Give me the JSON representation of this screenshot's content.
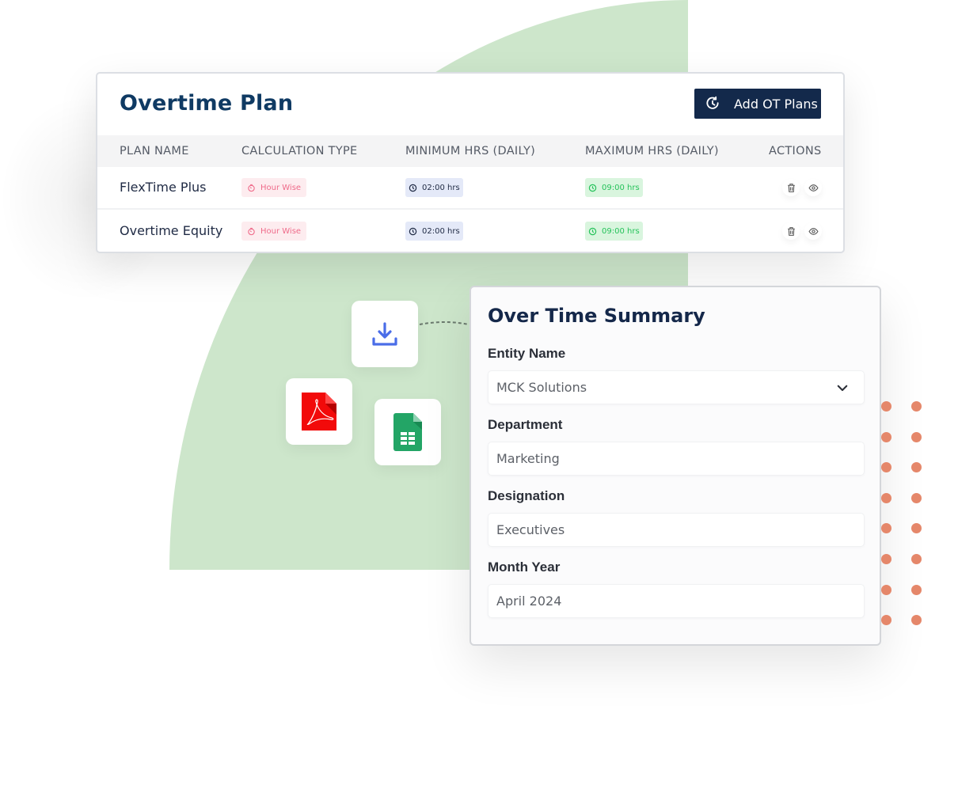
{
  "colors": {
    "accent_navy": "#13294b",
    "title_blue": "#0f3a63",
    "green_blob": "#cde6cb",
    "chip_pink_text": "#ef6b8a",
    "chip_green_text": "#25c25a",
    "dot_orange": "#e5876a"
  },
  "overtime_plan": {
    "title": "Overtime Plan",
    "add_button": {
      "label": "Add OT Plans",
      "icon": "clock-refresh-icon"
    },
    "columns": [
      "PLAN NAME",
      "CALCULATION TYPE",
      "MINIMUM HRS (DAILY)",
      "MAXIMUM HRS (DAILY)",
      "ACTIONS"
    ],
    "rows": [
      {
        "plan_name": "FlexTime Plus",
        "calculation_type": "Hour Wise",
        "min_hrs": "02:00 hrs",
        "max_hrs": "09:00 hrs",
        "actions": [
          "delete-icon",
          "view-icon"
        ]
      },
      {
        "plan_name": "Overtime Equity",
        "calculation_type": "Hour Wise",
        "min_hrs": "02:00 hrs",
        "max_hrs": "09:00 hrs",
        "actions": [
          "delete-icon",
          "view-icon"
        ]
      }
    ]
  },
  "export_tiles": [
    {
      "icon": "download-icon"
    },
    {
      "icon": "pdf-file-icon"
    },
    {
      "icon": "spreadsheet-file-icon"
    }
  ],
  "summary": {
    "title": "Over Time Summary",
    "fields": [
      {
        "label": "Entity Name",
        "value": "MCK Solutions",
        "type": "select"
      },
      {
        "label": "Department",
        "value": "Marketing",
        "type": "text"
      },
      {
        "label": "Designation",
        "value": "Executives",
        "type": "text"
      },
      {
        "label": "Month Year",
        "value": "April 2024",
        "type": "text"
      }
    ]
  }
}
